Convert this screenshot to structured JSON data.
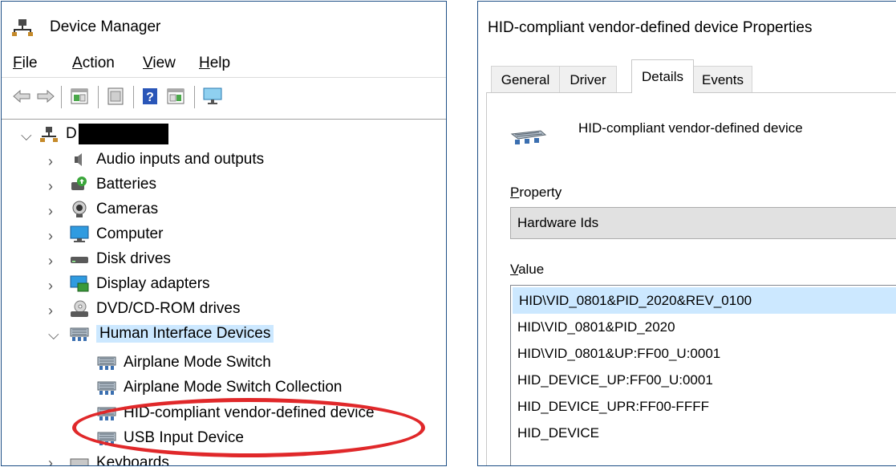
{
  "device_manager": {
    "title": "Device Manager",
    "menu": [
      "File",
      "Action",
      "View",
      "Help"
    ],
    "toolbar_icons": [
      "back-arrow-icon",
      "forward-arrow-icon",
      "properties-pane-icon",
      "show-hidden-icon",
      "help-icon",
      "update-driver-icon",
      "monitor-scan-icon"
    ],
    "root_label": "D",
    "tree_items": [
      {
        "label": "Audio inputs and outputs",
        "icon": "speaker-icon"
      },
      {
        "label": "Batteries",
        "icon": "battery-icon"
      },
      {
        "label": "Cameras",
        "icon": "camera-icon"
      },
      {
        "label": "Computer",
        "icon": "computer-icon"
      },
      {
        "label": "Disk drives",
        "icon": "disk-drive-icon"
      },
      {
        "label": "Display adapters",
        "icon": "display-adapter-icon"
      },
      {
        "label": "DVD/CD-ROM drives",
        "icon": "dvd-drive-icon"
      },
      {
        "label": "Human Interface Devices",
        "icon": "hid-icon"
      },
      {
        "label": "Airplane Mode Switch",
        "icon": "hid-icon"
      },
      {
        "label": "Airplane Mode Switch Collection",
        "icon": "hid-icon"
      },
      {
        "label": "HID-compliant vendor-defined device",
        "icon": "hid-icon"
      },
      {
        "label": "USB Input Device",
        "icon": "hid-icon"
      },
      {
        "label": "Keyboards",
        "icon": "keyboard-icon"
      }
    ],
    "highlight_color": "#e0282a"
  },
  "properties": {
    "title": "HID-compliant vendor-defined device Properties",
    "tabs": [
      "General",
      "Driver",
      "Details",
      "Events"
    ],
    "active_tab": "Details",
    "device_name": "HID-compliant vendor-defined device",
    "property_label": "Property",
    "property_value": "Hardware Ids",
    "value_label": "Value",
    "values": [
      "HID\\VID_0801&PID_2020&REV_0100",
      "HID\\VID_0801&PID_2020",
      "HID\\VID_0801&UP:FF00_U:0001",
      "HID_DEVICE_UP:FF00_U:0001",
      "HID_DEVICE_UPR:FF00-FFFF",
      "HID_DEVICE"
    ]
  }
}
